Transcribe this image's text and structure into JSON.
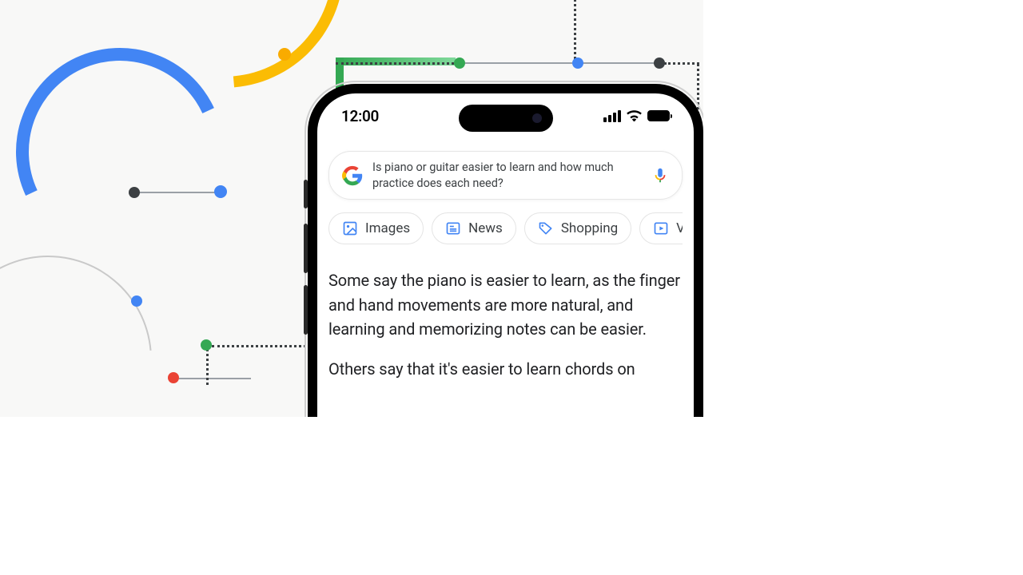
{
  "statusbar": {
    "time": "12:00"
  },
  "search": {
    "query": "Is piano or guitar easier to learn and how much practice does each need?"
  },
  "chips": [
    {
      "icon": "image-icon",
      "label": "Images"
    },
    {
      "icon": "news-icon",
      "label": "News"
    },
    {
      "icon": "tag-icon",
      "label": "Shopping"
    },
    {
      "icon": "play-icon",
      "label": "Vide"
    }
  ],
  "result": {
    "p1": "Some say the piano is easier to learn, as the finger and hand movements are more natural, and learning and memorizing notes can be easier.",
    "p2": "Others say that it's easier to learn chords on"
  },
  "colors": {
    "blue": "#4285f4",
    "red": "#ea4335",
    "yellow": "#fbbc04",
    "green": "#34a853"
  }
}
